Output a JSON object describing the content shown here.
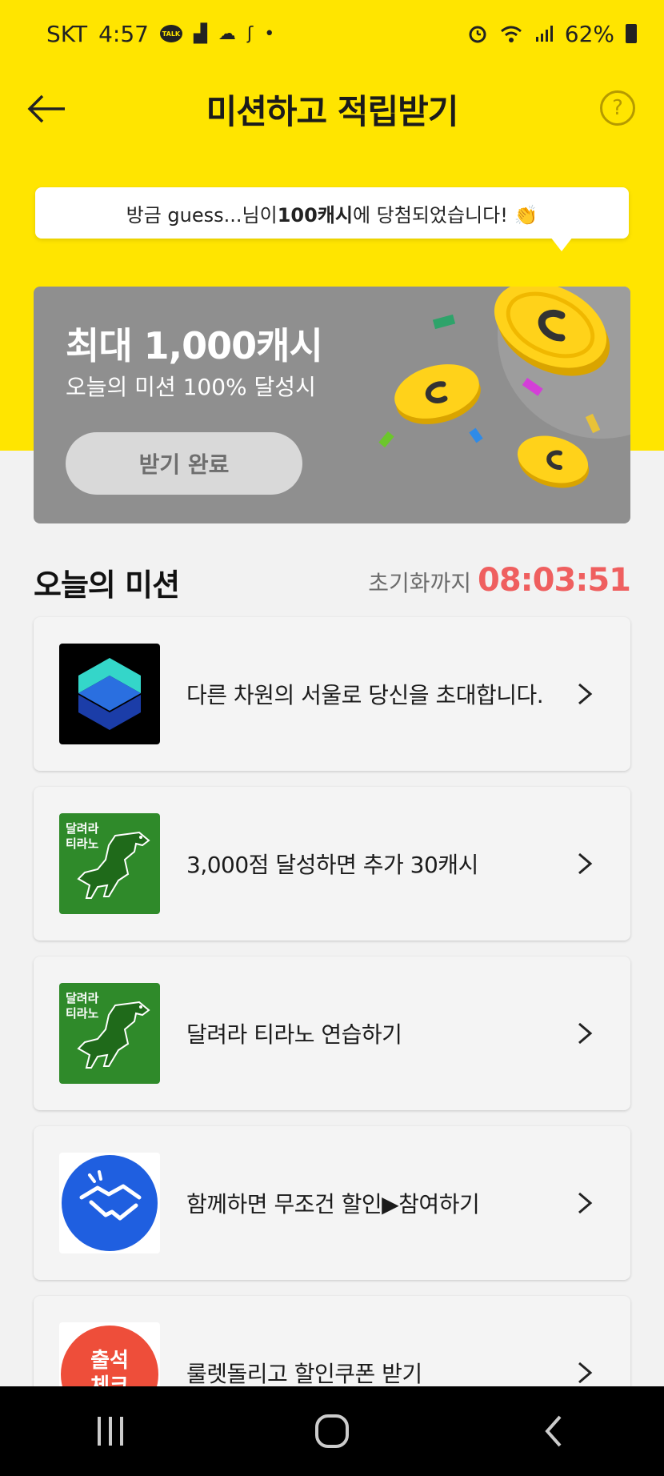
{
  "status_bar": {
    "carrier": "SKT",
    "time": "4:57",
    "talk_badge": "TALK",
    "battery": "62%",
    "icons": [
      "talk-icon",
      "notification-icon",
      "cloud-icon",
      "app-icon",
      "dot-icon",
      "alarm-icon",
      "wifi-icon",
      "signal-icon",
      "battery-icon"
    ]
  },
  "header": {
    "title": "미션하고 적립받기",
    "help_label": "?"
  },
  "notice": {
    "prefix": "방금 guess...님이 ",
    "amount": "100캐시",
    "suffix": "에 당첨되었습니다! 👏"
  },
  "banner": {
    "title": "최대 1,000캐시",
    "subtitle": "오늘의 미션 100% 달성시",
    "button_label": "받기 완료"
  },
  "section": {
    "title": "오늘의 미션",
    "reset_label": "초기화까지",
    "reset_timer": "08:03:51"
  },
  "missions": [
    {
      "label": "다른 차원의 서울로 당신을 초대합니다.",
      "icon": "s-logo-icon"
    },
    {
      "label": "3,000점 달성하면 추가 30캐시",
      "icon": "tirano-game-icon",
      "icon_text": "달려라 티라노"
    },
    {
      "label": "달려라 티라노 연습하기",
      "icon": "tirano-game-icon",
      "icon_text": "달려라 티라노"
    },
    {
      "label": "함께하면 무조건 할인▶참여하기",
      "icon": "handshake-icon"
    },
    {
      "label": "룰렛돌리고 할인쿠폰 받기",
      "icon": "attendance-check-icon",
      "icon_text": "출석 체크"
    }
  ],
  "colors": {
    "brand_yellow": "#ffe500",
    "timer_red": "#ef5f5f",
    "banner_gray": "#8f8f8f",
    "tirano_green": "#2f8a2a",
    "handshake_blue": "#1f5fe0"
  }
}
